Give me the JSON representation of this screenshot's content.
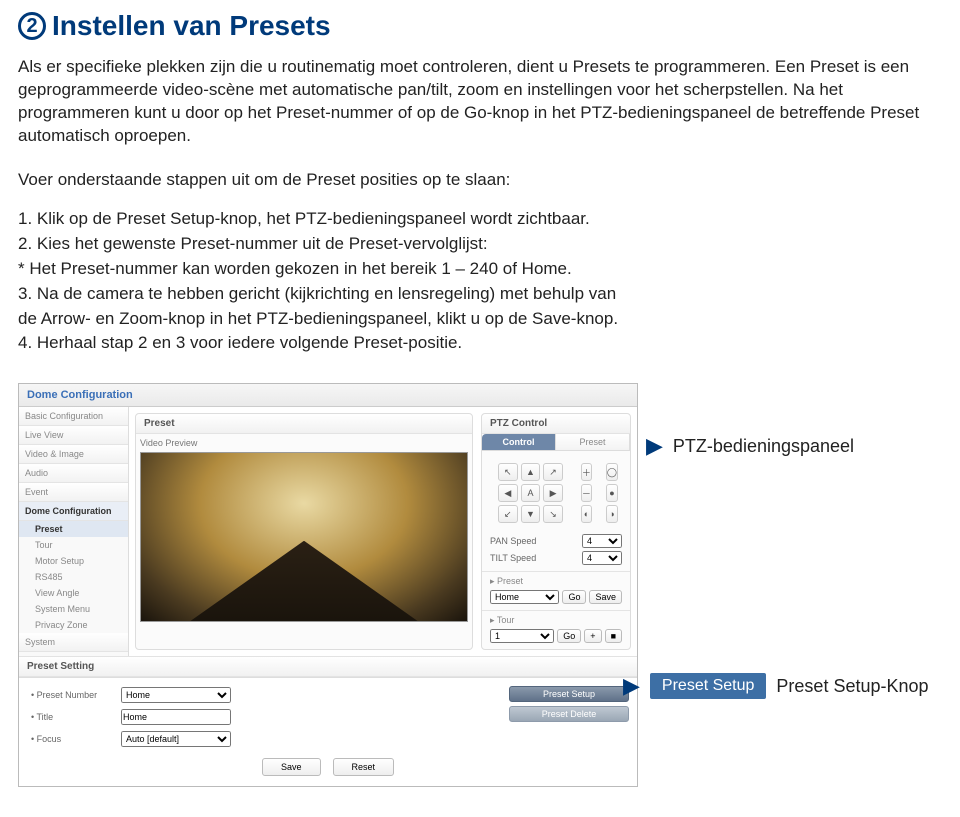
{
  "heading": {
    "number": "2",
    "title": "Instellen van Presets"
  },
  "intro": "Als er specifieke plekken zijn die u routinematig moet controleren, dient u Presets te programmeren. Een Preset is een geprogrammeerde video-scène met automatische pan/tilt, zoom en instellingen voor het scherpstellen. Na het programmeren kunt u door op het Preset-nummer of op de Go-knop in het PTZ-bedieningspaneel de betreffende Preset automatisch oproepen.",
  "subheading": "Voer onderstaande stappen uit om de Preset posities op te slaan:",
  "steps": {
    "s1": "1. Klik op de Preset Setup-knop, het PTZ-bedieningspaneel wordt zichtbaar.",
    "s2a": "2. Kies het gewenste Preset-nummer uit de Preset-vervolglijst:",
    "s2b": "   * Het Preset-nummer kan worden gekozen in het bereik 1 – 240 of Home.",
    "s3a": "3. Na de camera te hebben gericht (kijkrichting en lensregeling) met behulp van",
    "s3b": "    de Arrow- en Zoom-knop in het PTZ-bedieningspaneel, klikt u op de Save-knop.",
    "s4": "4. Herhaal stap 2 en 3 voor iedere volgende Preset-positie."
  },
  "callouts": {
    "ptz": "PTZ-bedieningspaneel",
    "setup_badge": "Preset Setup",
    "setup_label": "Preset Setup-Knop"
  },
  "app": {
    "title": "Dome Configuration",
    "sidebar": {
      "groups": {
        "basic": "Basic Configuration",
        "liveview": "Live View",
        "videoimage": "Video & Image",
        "audio": "Audio",
        "event": "Event",
        "dome": "Dome Configuration",
        "system": "System"
      },
      "subs": {
        "preset": "Preset",
        "tour": "Tour",
        "motor": "Motor Setup",
        "rs485": "RS485",
        "viewangle": "View Angle",
        "sysmenu": "System Menu",
        "privacy": "Privacy Zone"
      }
    },
    "preset_panel": {
      "title": "Preset",
      "preview": "Video Preview"
    },
    "ptz": {
      "title": "PTZ Control",
      "tab_control": "Control",
      "tab_preset": "Preset",
      "arrows": {
        "ul": "↖",
        "u": "▲",
        "ur": "↗",
        "l": "◀",
        "c": "A",
        "r": "▶",
        "dl": "↙",
        "d": "▼",
        "dr": "↘"
      },
      "zoom": {
        "in": "＋",
        "out": "－",
        "focus_near": "◐",
        "focus_far": "◑",
        "iris_open": "◯",
        "iris_close": "●"
      },
      "speed": {
        "pan_label": "PAN Speed",
        "pan_value": "4",
        "tilt_label": "TILT Speed",
        "tilt_value": "4"
      },
      "preset_section": {
        "label": "Preset",
        "select": "Home",
        "go": "Go",
        "save": "Save"
      },
      "tour_section": {
        "label": "Tour",
        "select": "1",
        "go": "Go",
        "plus": "+",
        "stop": "■"
      }
    },
    "bottom": {
      "title": "Preset Setting",
      "preset_number_label": "Preset Number",
      "preset_number_value": "Home",
      "title_label": "Title",
      "title_value": "Home",
      "focus_label": "Focus",
      "focus_value": "Auto [default]",
      "btn_setup": "Preset Setup",
      "btn_delete": "Preset Delete",
      "btn_save": "Save",
      "btn_reset": "Reset"
    }
  }
}
